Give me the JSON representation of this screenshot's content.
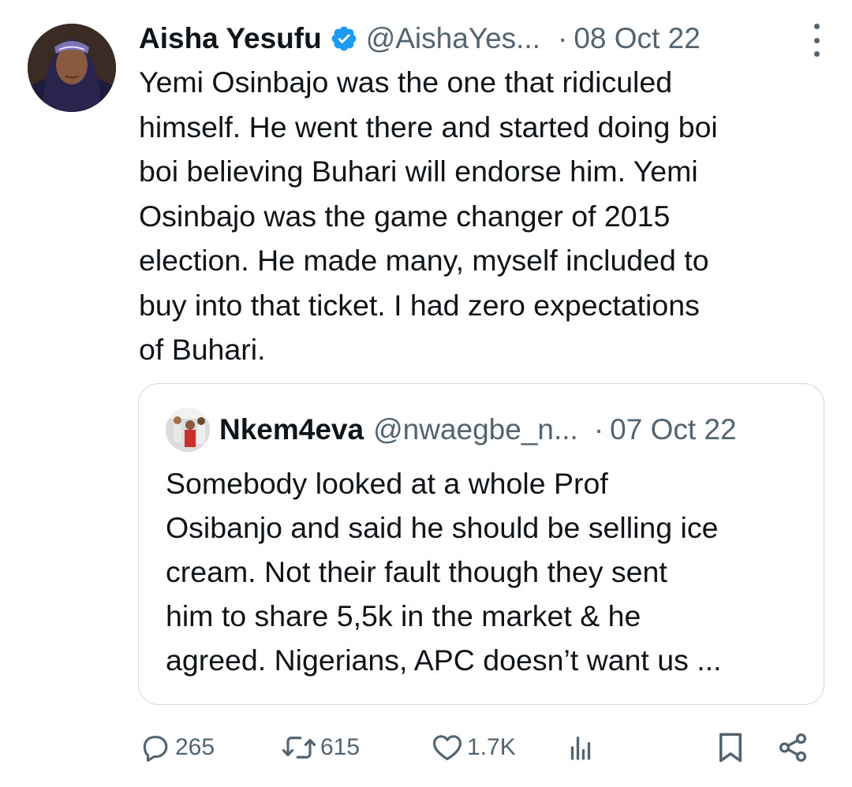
{
  "tweet": {
    "author_name": "Aisha Yesufu",
    "author_handle": "@AishaYes...",
    "separator": "·",
    "date": "08 Oct 22",
    "text_lines": [
      "Yemi Osinbajo was the one that ridiculed",
      "himself. He went there and started doing boi",
      "boi believing Buhari will endorse him. Yemi",
      "Osinbajo was the game changer of 2015",
      "election. He made many, myself included to",
      "buy into that ticket. I had zero expectations",
      "of Buhari."
    ]
  },
  "quote": {
    "author_name": "Nkem4eva",
    "author_handle": "@nwaegbe_n...",
    "separator": "·",
    "date": "07 Oct 22",
    "text_lines": [
      "Somebody looked at a whole Prof",
      "Osibanjo and said he should be selling ice",
      "cream. Not their fault though they sent",
      "him to share 5,5k in the market & he",
      "agreed. Nigerians, APC doesn’t want us ..."
    ]
  },
  "actions": {
    "replies": "265",
    "reposts": "615",
    "likes": "1.7K"
  },
  "colors": {
    "text": "#0f1419",
    "secondary": "#536471",
    "verified": "#1d9bf0",
    "border": "#cfd9de"
  },
  "icons": [
    "verified-badge-icon",
    "more-icon",
    "reply-icon",
    "repost-icon",
    "like-icon",
    "views-icon",
    "bookmark-icon",
    "share-icon"
  ]
}
